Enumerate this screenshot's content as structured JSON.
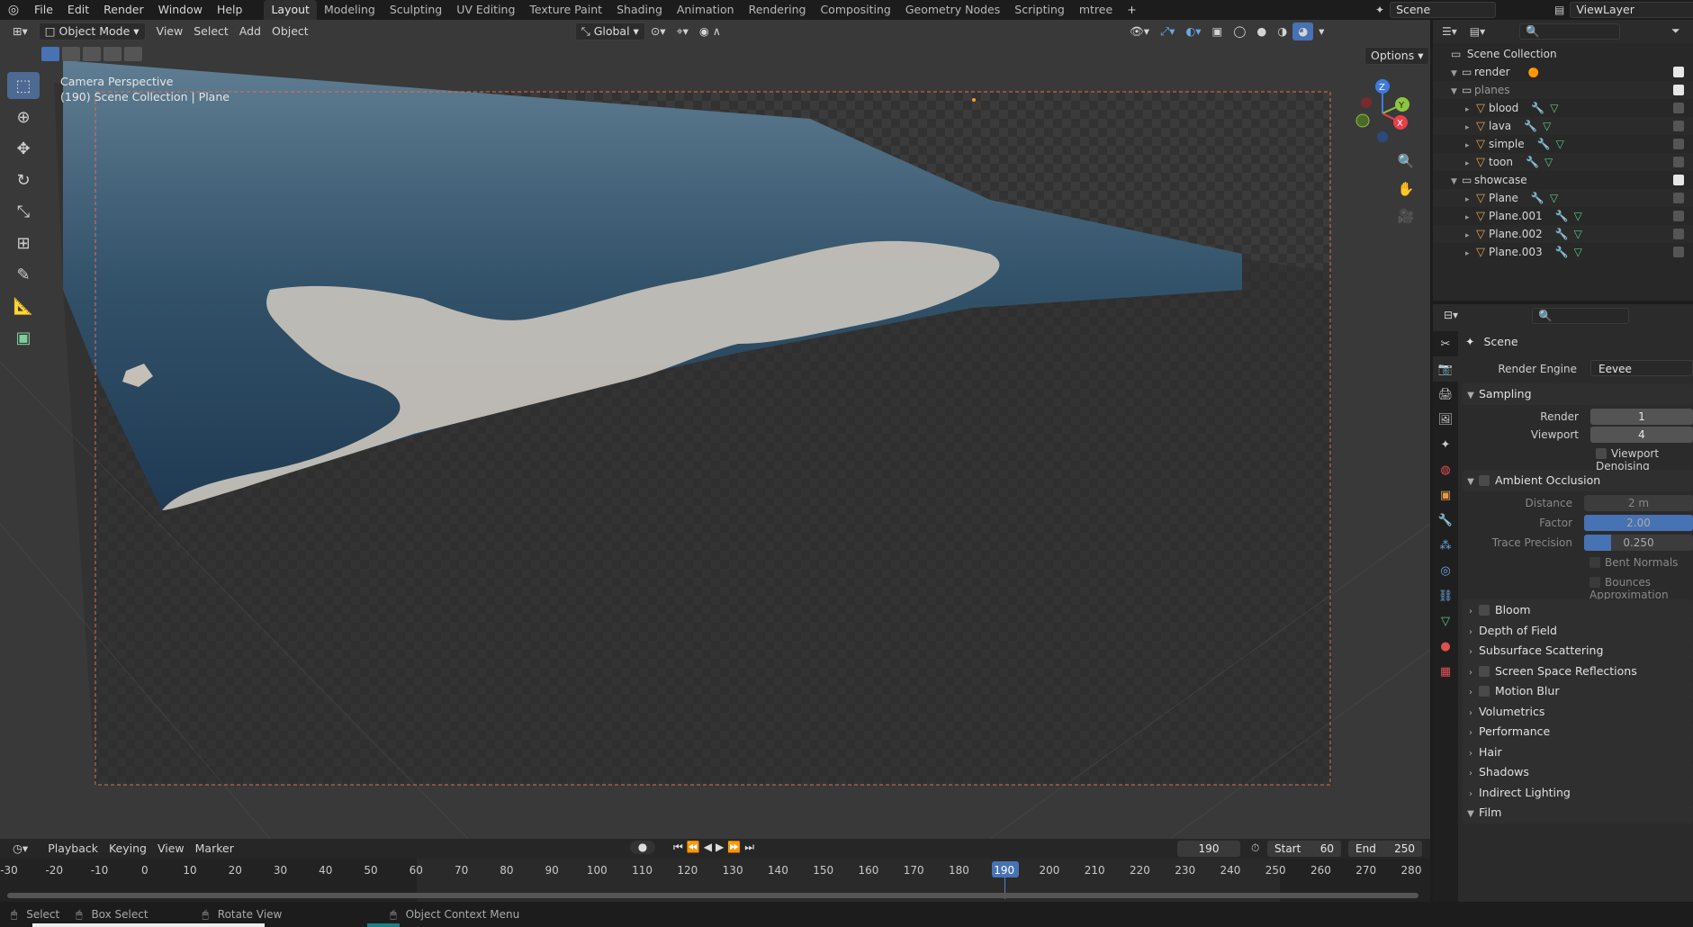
{
  "menu": [
    "File",
    "Edit",
    "Render",
    "Window",
    "Help"
  ],
  "workspaces": [
    "Layout",
    "Modeling",
    "Sculpting",
    "UV Editing",
    "Texture Paint",
    "Shading",
    "Animation",
    "Rendering",
    "Compositing",
    "Geometry Nodes",
    "Scripting",
    "mtree"
  ],
  "active_workspace": "Layout",
  "scene_name": "Scene",
  "view_layer": "ViewLayer",
  "viewport": {
    "mode": "Object Mode",
    "menus": [
      "View",
      "Select",
      "Add",
      "Object"
    ],
    "transform_orientation": "Global",
    "options_label": "Options",
    "info_line1": "Camera Perspective",
    "info_line2": "(190) Scene Collection | Plane"
  },
  "outliner": {
    "root": "Scene Collection",
    "rows": [
      {
        "label": "render",
        "type": "collection",
        "depth": 0
      },
      {
        "label": "planes",
        "type": "collection",
        "depth": 0
      },
      {
        "label": "blood",
        "type": "object",
        "depth": 1
      },
      {
        "label": "lava",
        "type": "object",
        "depth": 1
      },
      {
        "label": "simple",
        "type": "object",
        "depth": 1
      },
      {
        "label": "toon",
        "type": "object",
        "depth": 1
      },
      {
        "label": "showcase",
        "type": "collection",
        "depth": 0
      },
      {
        "label": "Plane",
        "type": "object",
        "depth": 1
      },
      {
        "label": "Plane.001",
        "type": "object",
        "depth": 1
      },
      {
        "label": "Plane.002",
        "type": "object",
        "depth": 1
      },
      {
        "label": "Plane.003",
        "type": "object",
        "depth": 1
      }
    ]
  },
  "properties": {
    "context": "Scene",
    "render_engine_label": "Render Engine",
    "render_engine": "Eevee",
    "sampling": {
      "title": "Sampling",
      "render_label": "Render",
      "render": "1",
      "viewport_label": "Viewport",
      "viewport": "4",
      "denoise_label": "Viewport Denoising"
    },
    "ao": {
      "title": "Ambient Occlusion",
      "distance_label": "Distance",
      "distance": "2 m",
      "factor_label": "Factor",
      "factor": "2.00",
      "factor_fill": 1.0,
      "trace_label": "Trace Precision",
      "trace": "0.250",
      "trace_fill": 0.25,
      "bent_label": "Bent Normals",
      "bounces_label": "Bounces Approximation"
    },
    "panels": [
      "Bloom",
      "Depth of Field",
      "Subsurface Scattering",
      "Screen Space Reflections",
      "Motion Blur",
      "Volumetrics",
      "Performance",
      "Hair",
      "Shadows",
      "Indirect Lighting",
      "Film"
    ]
  },
  "timeline": {
    "menus": [
      "Playback",
      "Keying",
      "View",
      "Marker"
    ],
    "current_frame": "190",
    "start_label": "Start",
    "start": "60",
    "end_label": "End",
    "end": "250",
    "ticks": [
      "-30",
      "-20",
      "-10",
      "0",
      "10",
      "20",
      "30",
      "40",
      "50",
      "60",
      "70",
      "80",
      "90",
      "100",
      "110",
      "120",
      "130",
      "140",
      "150",
      "160",
      "170",
      "180",
      "190",
      "200",
      "210",
      "220",
      "230",
      "240",
      "250",
      "260",
      "270",
      "280"
    ]
  },
  "statusbar": [
    "Select",
    "Box Select",
    "Rotate View",
    "Object Context Menu"
  ]
}
